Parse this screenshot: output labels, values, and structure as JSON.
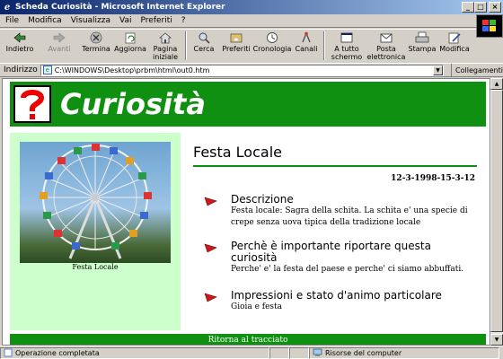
{
  "window": {
    "title": "Scheda Curiosità - Microsoft Internet Explorer"
  },
  "menu": [
    "File",
    "Modifica",
    "Visualizza",
    "Vai",
    "Preferiti",
    "?"
  ],
  "toolbar": [
    {
      "label": "Indietro",
      "icon": "back-arrow-icon",
      "disabled": false,
      "dropdown": true
    },
    {
      "label": "Avanti",
      "icon": "forward-arrow-icon",
      "disabled": true,
      "dropdown": true
    },
    {
      "label": "Termina",
      "icon": "stop-icon",
      "disabled": false
    },
    {
      "label": "Aggiorna",
      "icon": "refresh-icon",
      "disabled": false
    },
    {
      "label": "Pagina iniziale",
      "icon": "home-icon",
      "disabled": false
    },
    {
      "label": "Cerca",
      "icon": "search-icon",
      "disabled": false
    },
    {
      "label": "Preferiti",
      "icon": "favorites-icon",
      "disabled": false
    },
    {
      "label": "Cronologia",
      "icon": "history-icon",
      "disabled": false
    },
    {
      "label": "Canali",
      "icon": "channels-icon",
      "disabled": false
    },
    {
      "label": "A tutto schermo",
      "icon": "fullscreen-icon",
      "disabled": false
    },
    {
      "label": "Posta elettronica",
      "icon": "mail-icon",
      "disabled": false
    },
    {
      "label": "Stampa",
      "icon": "print-icon",
      "disabled": false
    },
    {
      "label": "Modifica",
      "icon": "edit-icon",
      "disabled": false
    }
  ],
  "address": {
    "label": "Indirizzo",
    "value": "C:\\WINDOWS\\Desktop\\prbm\\html\\out0.htm",
    "links": "Collegamenti"
  },
  "page": {
    "header_title": "Curiosità",
    "photo_caption": "Festa Locale",
    "section_title": "Festa Locale",
    "date": "12-3-1998-15-3-12",
    "items": [
      {
        "heading": "Descrizione",
        "text": "Festa locale: Sagra della schita. La schita e' una specie di crepe senza uova tipica della tradizione locale"
      },
      {
        "heading": "Perchè è importante riportare questa curiosità",
        "text": "Perche' e' la festa del paese e perche' ci siamo abbuffati."
      },
      {
        "heading": "Impressioni e stato d'animo particolare",
        "text": "Gioia e festa"
      }
    ],
    "footer": "Ritorna al tracciato"
  },
  "status": {
    "text": "Operazione completata",
    "zone": "Risorse del computer"
  },
  "colors": {
    "green": "#109010",
    "pane": "#ccffcc",
    "titlebar": "#0a246a"
  }
}
